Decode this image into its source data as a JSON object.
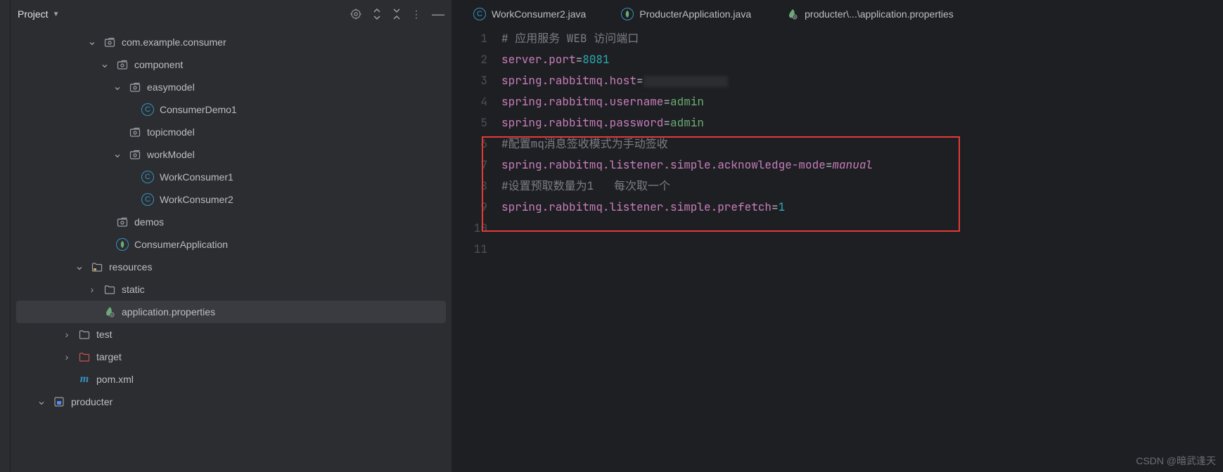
{
  "header": {
    "project_label": "Project"
  },
  "tree": {
    "indent_base": 18,
    "items": [
      {
        "depth": 6,
        "arrow": "down",
        "icon": "package",
        "label": "com.example.consumer"
      },
      {
        "depth": 7,
        "arrow": "down",
        "icon": "package",
        "label": "component"
      },
      {
        "depth": 8,
        "arrow": "down",
        "icon": "package",
        "label": "easymodel"
      },
      {
        "depth": 9,
        "arrow": "none",
        "icon": "class",
        "label": "ConsumerDemo1"
      },
      {
        "depth": 8,
        "arrow": "none",
        "icon": "package",
        "label": "topicmodel"
      },
      {
        "depth": 8,
        "arrow": "down",
        "icon": "package",
        "label": "workModel"
      },
      {
        "depth": 9,
        "arrow": "none",
        "icon": "class",
        "label": "WorkConsumer1"
      },
      {
        "depth": 9,
        "arrow": "none",
        "icon": "class",
        "label": "WorkConsumer2"
      },
      {
        "depth": 7,
        "arrow": "none",
        "icon": "package",
        "label": "demos"
      },
      {
        "depth": 7,
        "arrow": "none",
        "icon": "spring",
        "label": "ConsumerApplication"
      },
      {
        "depth": 5,
        "arrow": "down",
        "icon": "resource-folder",
        "label": "resources"
      },
      {
        "depth": 6,
        "arrow": "right",
        "icon": "folder",
        "label": "static"
      },
      {
        "depth": 6,
        "arrow": "none",
        "icon": "props",
        "label": "application.properties",
        "selected": true
      },
      {
        "depth": 4,
        "arrow": "right",
        "icon": "folder",
        "label": "test"
      },
      {
        "depth": 4,
        "arrow": "right",
        "icon": "folder-red",
        "label": "target"
      },
      {
        "depth": 4,
        "arrow": "none",
        "icon": "maven",
        "label": "pom.xml"
      },
      {
        "depth": 2,
        "arrow": "down",
        "icon": "module",
        "label": "producter"
      }
    ]
  },
  "tabs": [
    {
      "icon": "class",
      "label": "WorkConsumer2.java"
    },
    {
      "icon": "spring",
      "label": "ProducterApplication.java"
    },
    {
      "icon": "props",
      "label": "producter\\...\\application.properties"
    }
  ],
  "code": {
    "lines": [
      {
        "n": 1,
        "type": "comment",
        "text": "# 应用服务 WEB 访问端口"
      },
      {
        "n": 2,
        "type": "kv",
        "key": "server.port",
        "val": "8081",
        "valClass": "num"
      },
      {
        "n": 3,
        "type": "kv-redacted",
        "key": "spring.rabbitmq.host"
      },
      {
        "n": 4,
        "type": "kv",
        "key": "spring.rabbitmq.username",
        "val": "admin",
        "valClass": "val"
      },
      {
        "n": 5,
        "type": "kv",
        "key": "spring.rabbitmq.password",
        "val": "admin",
        "valClass": "val"
      },
      {
        "n": 6,
        "type": "comment",
        "text": "#配置mq消息签收模式为手动签收"
      },
      {
        "n": 7,
        "type": "kv",
        "key": "spring.rabbitmq.listener.simple.acknowledge-mode",
        "val": "manual",
        "valClass": "ital"
      },
      {
        "n": 8,
        "type": "comment",
        "text": "#设置预取数量为1   每次取一个"
      },
      {
        "n": 9,
        "type": "kv",
        "key": "spring.rabbitmq.listener.simple.prefetch",
        "val": "1",
        "valClass": "num"
      },
      {
        "n": 10,
        "type": "empty"
      },
      {
        "n": 11,
        "type": "empty"
      }
    ]
  },
  "watermark": "CSDN @暗武逢天"
}
